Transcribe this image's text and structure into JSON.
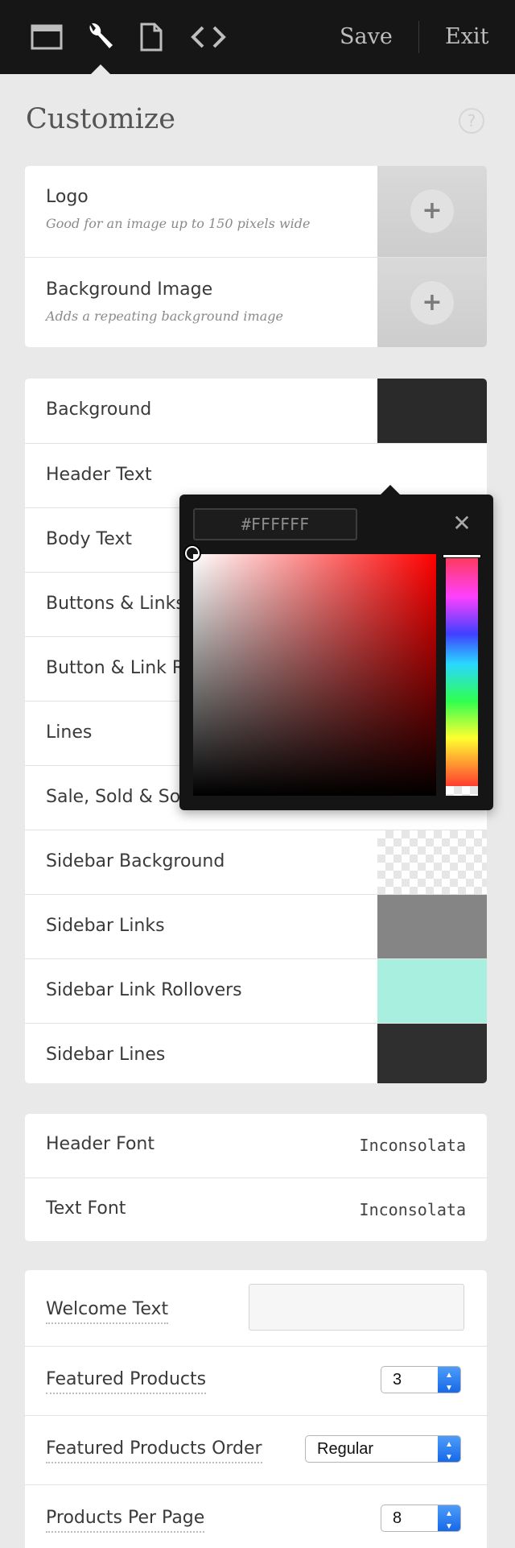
{
  "toolbar": {
    "icons": [
      "window-icon",
      "wrench-icon",
      "document-icon",
      "code-icon"
    ],
    "save_label": "Save",
    "exit_label": "Exit"
  },
  "page": {
    "title": "Customize",
    "help_icon": "?"
  },
  "images": [
    {
      "label": "Logo",
      "sub": "Good for an image up to 150 pixels wide",
      "add_icon": "+"
    },
    {
      "label": "Background Image",
      "sub": "Adds a repeating background image",
      "add_icon": "+"
    }
  ],
  "colors": [
    {
      "label": "Background",
      "color": "#2a2a2a"
    },
    {
      "label": "Header Text",
      "color": "#ffffff"
    },
    {
      "label": "Body Text",
      "color": ""
    },
    {
      "label": "Buttons & Links",
      "color": ""
    },
    {
      "label": "Button & Link R",
      "color": ""
    },
    {
      "label": "Lines",
      "color": ""
    },
    {
      "label": "Sale, Sold & Soo",
      "color": ""
    },
    {
      "label": "Sidebar Background",
      "color": "transparent"
    },
    {
      "label": "Sidebar Links",
      "color": "#858585"
    },
    {
      "label": "Sidebar Link Rollovers",
      "color": "#a9efe0"
    },
    {
      "label": "Sidebar Lines",
      "color": "#2f2f2f"
    }
  ],
  "fonts": [
    {
      "label": "Header Font",
      "value": "Inconsolata"
    },
    {
      "label": "Text Font",
      "value": "Inconsolata"
    }
  ],
  "options": {
    "welcome_label": "Welcome Text",
    "welcome_value": "",
    "featured_label": "Featured Products",
    "featured_value": "3",
    "order_label": "Featured Products Order",
    "order_value": "Regular",
    "per_page_label": "Products Per Page",
    "per_page_value": "8"
  },
  "picker": {
    "hex_value": "#FFFFFF",
    "close_icon": "✕",
    "hue_colors": [
      "#ff3a5a",
      "#ff40ff",
      "#4040ff",
      "#29d8ff",
      "#30ff50",
      "#ffff30",
      "#ff3030"
    ],
    "base_hue": "#ff0000"
  }
}
